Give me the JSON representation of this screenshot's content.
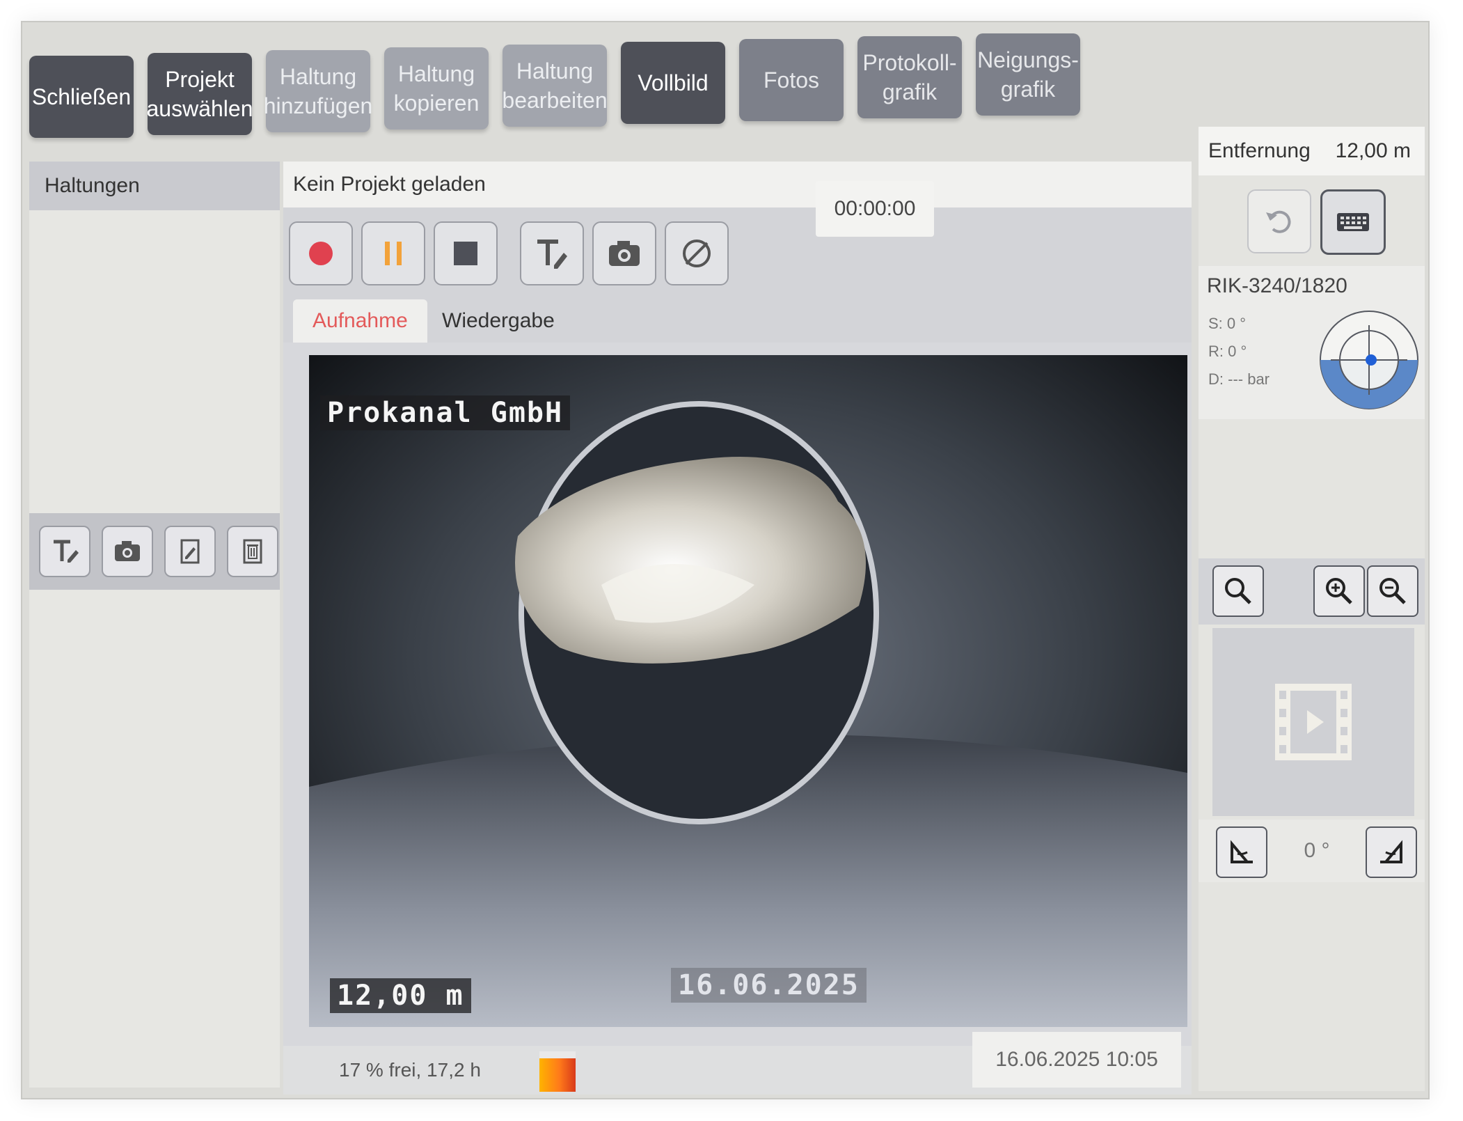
{
  "toolbar": {
    "close": "Schließen",
    "select_project": "Projekt\nauswählen",
    "add_section": "Haltung\nhinzufügen",
    "copy_section": "Haltung\nkopieren",
    "edit_section": "Haltung\nbearbeiten",
    "fullscreen": "Vollbild",
    "photos": "Fotos",
    "protocol_graphic": "Protokoll-\ngrafik",
    "inclination_graphic": "Neigungs-\ngrafik"
  },
  "sidebar": {
    "header": "Haltungen"
  },
  "project": {
    "status": "Kein Projekt geladen"
  },
  "recording": {
    "timer": "00:00:00"
  },
  "tabs": {
    "recording": "Aufnahme",
    "playback": "Wiedergabe"
  },
  "video_osd": {
    "company": "Prokanal GmbH",
    "distance": "12,00 m",
    "date": "16.06.2025"
  },
  "status": {
    "storage_text": "17 % frei, 17,2 h",
    "storage_free_fraction": 0.17,
    "datetime": "16.06.2025 10:05"
  },
  "right_panel": {
    "distance_label": "Entfernung",
    "distance_value": "12,00 m",
    "sensor_name": "RIK-3240/1820",
    "sensor_s": "S: 0 °",
    "sensor_r": "R: 0 °",
    "sensor_d": "D: --- bar",
    "rotation_value": "0 °"
  },
  "colors": {
    "accent_red": "#e35a5a",
    "record_red": "#e0414f",
    "pause_orange": "#f2a23a",
    "gauge_blue": "#5b88c8"
  },
  "icons": [
    "text-edit-icon",
    "camera-icon",
    "edit-document-icon",
    "delete-document-icon",
    "record-icon",
    "pause-icon",
    "stop-icon",
    "no-entry-icon",
    "undo-icon",
    "keyboard-icon",
    "search-icon",
    "zoom-in-icon",
    "zoom-out-icon",
    "film-icon",
    "rotate-left-icon",
    "rotate-right-icon"
  ]
}
